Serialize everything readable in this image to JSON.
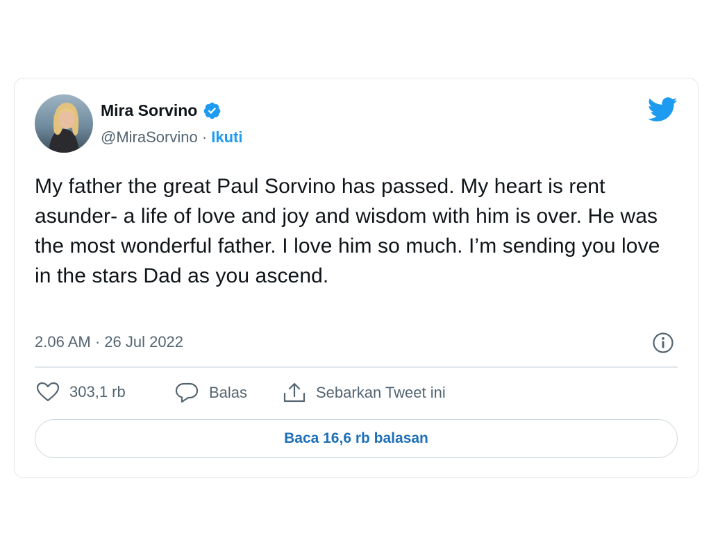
{
  "author": {
    "name": "Mira Sorvino",
    "handle": "@MiraSorvino",
    "separator": " · ",
    "follow_label": "Ikuti",
    "verified_icon": "verified-badge-icon"
  },
  "brand_icon": "twitter-bird-icon",
  "tweet": {
    "text": "My father the great Paul Sorvino has passed. My heart is rent asunder- a life of love and joy and wisdom with him is over. He was the most wonderful father. I love him so much. I’m sending you love in the stars Dad as you ascend.",
    "timestamp": "2.06 AM · 26 Jul 2022"
  },
  "actions": {
    "like_count": "303,1 rb",
    "reply_label": "Balas",
    "share_label": "Sebarkan Tweet ini"
  },
  "read_replies_label": "Baca 16,6 rb balasan",
  "colors": {
    "accent": "#1d9bf0",
    "text": "#0f1419",
    "muted": "#536471",
    "border": "#e1e6ea"
  }
}
